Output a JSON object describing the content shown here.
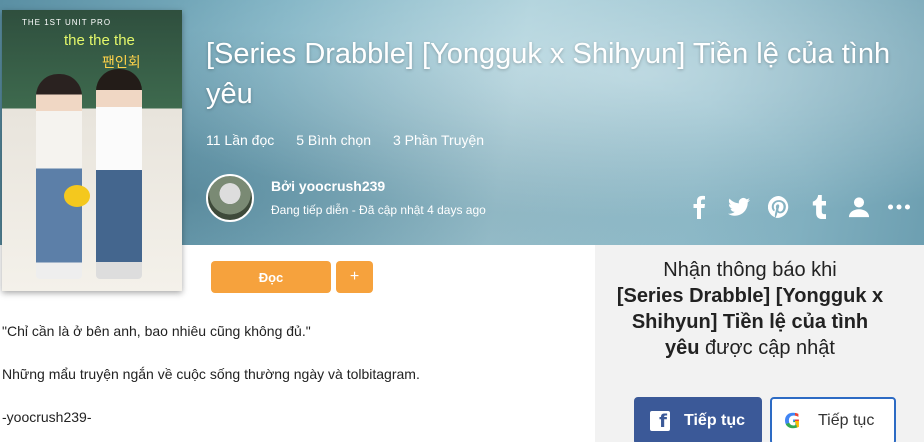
{
  "story": {
    "title": "[Series Drabble] [Yongguk x Shihyun] Tiền lệ của tình yêu",
    "reads": "11 Lần đọc",
    "votes": "5 Bình chọn",
    "parts": "3 Phần Truyện",
    "by": "Bởi yoocrush239",
    "status": "Đang tiếp diễn - Đã cập nhật 4 days ago"
  },
  "cover": {
    "line1": "THE 1ST UNIT PRO",
    "line2": "the the the",
    "line3": "팬인회"
  },
  "actions": {
    "read_label": "Đọc",
    "plus_label": "+"
  },
  "share_icons": [
    "facebook-icon",
    "twitter-icon",
    "pinterest-icon",
    "tumblr-icon",
    "user-icon",
    "more-icon"
  ],
  "description": {
    "quote": "\"Chỉ cần là ở bên anh, bao nhiêu cũng không đủ.\"",
    "body": "Những mẩu truyện ngắn về cuộc sống thường ngày và tolbitagram.",
    "signature": "-yoocrush239-"
  },
  "sidebar": {
    "notify_prefix": "Nhận thông báo khi",
    "notify_title": "[Series Drabble] [Yongguk x Shihyun] Tiền lệ của tình yêu",
    "notify_suffix": "được cập nhật",
    "facebook_label": "Tiếp tục",
    "google_label": "Tiếp tục"
  },
  "colors": {
    "accent": "#f6a23d",
    "facebook": "#3b5998",
    "google_border": "#2d6bc4"
  }
}
